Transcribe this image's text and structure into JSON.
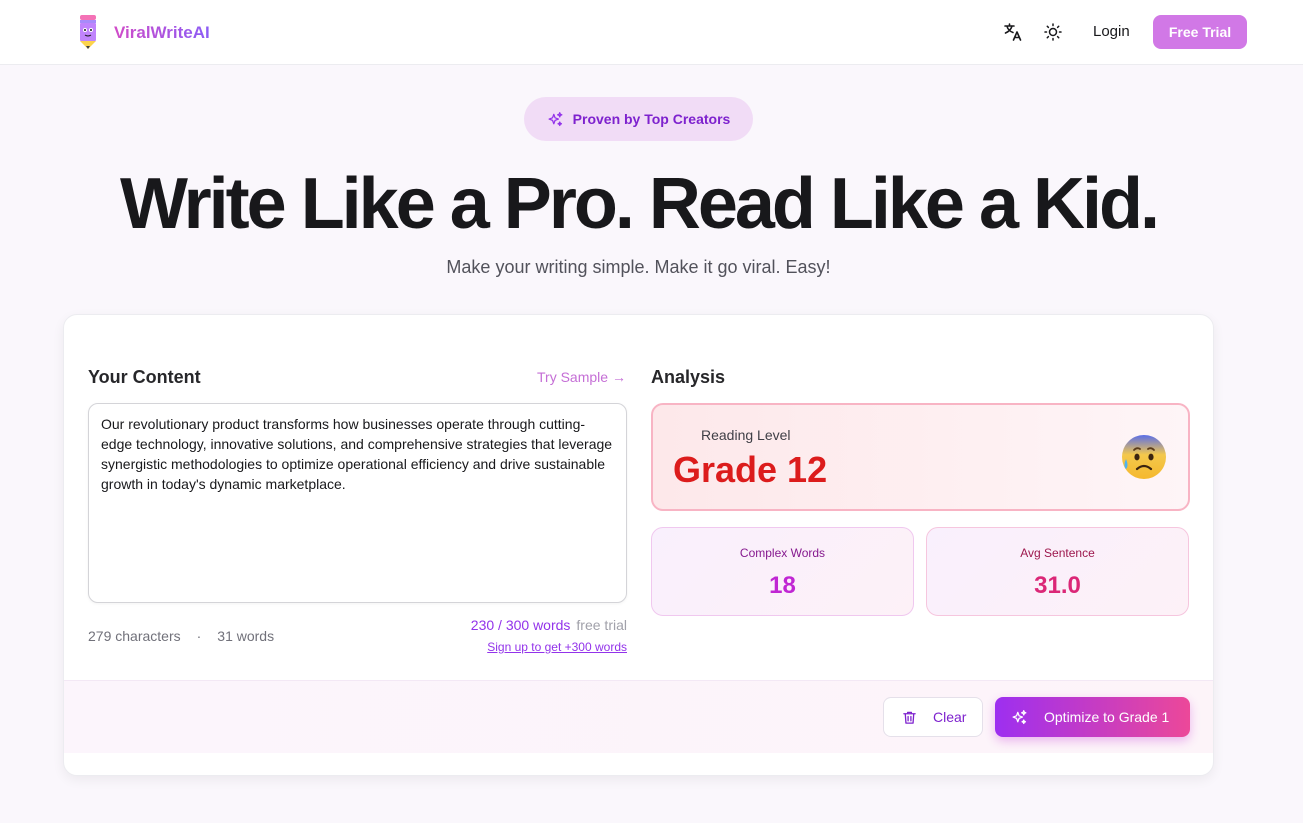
{
  "app": {
    "brand": "ViralWriteAI",
    "login_label": "Login",
    "free_trial_label": "Free Trial"
  },
  "hero": {
    "badge": "Proven by Top Creators",
    "headline": "Write Like a Pro. Read Like a Kid.",
    "subline": "Make your writing simple. Make it go viral. Easy!"
  },
  "editor": {
    "title": "Your Content",
    "try_sample": "Try Sample →",
    "text": "Our revolutionary product transforms how businesses operate through cutting-edge technology, innovative solutions, and comprehensive strategies that leverage synergistic methodologies to optimize operational efficiency and drive sustainable growth in today's dynamic marketplace.",
    "characters": "279 characters",
    "words": "31 words",
    "quota_used": "230 / 300 words",
    "quota_label": "free trial",
    "signup": "Sign up to get +300 words"
  },
  "analysis": {
    "title": "Analysis",
    "reading_label": "Reading Level",
    "reading_grade": "Grade 12",
    "complex_words_label": "Complex Words",
    "complex_words_value": "18",
    "avg_sentence_label": "Avg Sentence",
    "avg_sentence_value": "31.0"
  },
  "actions": {
    "clear_label": "Clear",
    "optimize_label": "Optimize to Grade 1"
  },
  "icons": {
    "logo": "pencil-mascot-icon",
    "translate": "translate-icon",
    "theme": "sun-icon",
    "sparkles": "sparkles-icon",
    "trash": "trash-icon",
    "emoji": "anxious-sweat-face-icon"
  },
  "colors": {
    "accent": "#9333ea",
    "brand_gradient_start": "#d14cc8",
    "brand_gradient_end": "#8b5cf6",
    "grade_red": "#dc1c1c",
    "complex_words_value": "#c026d3",
    "avg_sentence_value": "#db2777"
  }
}
